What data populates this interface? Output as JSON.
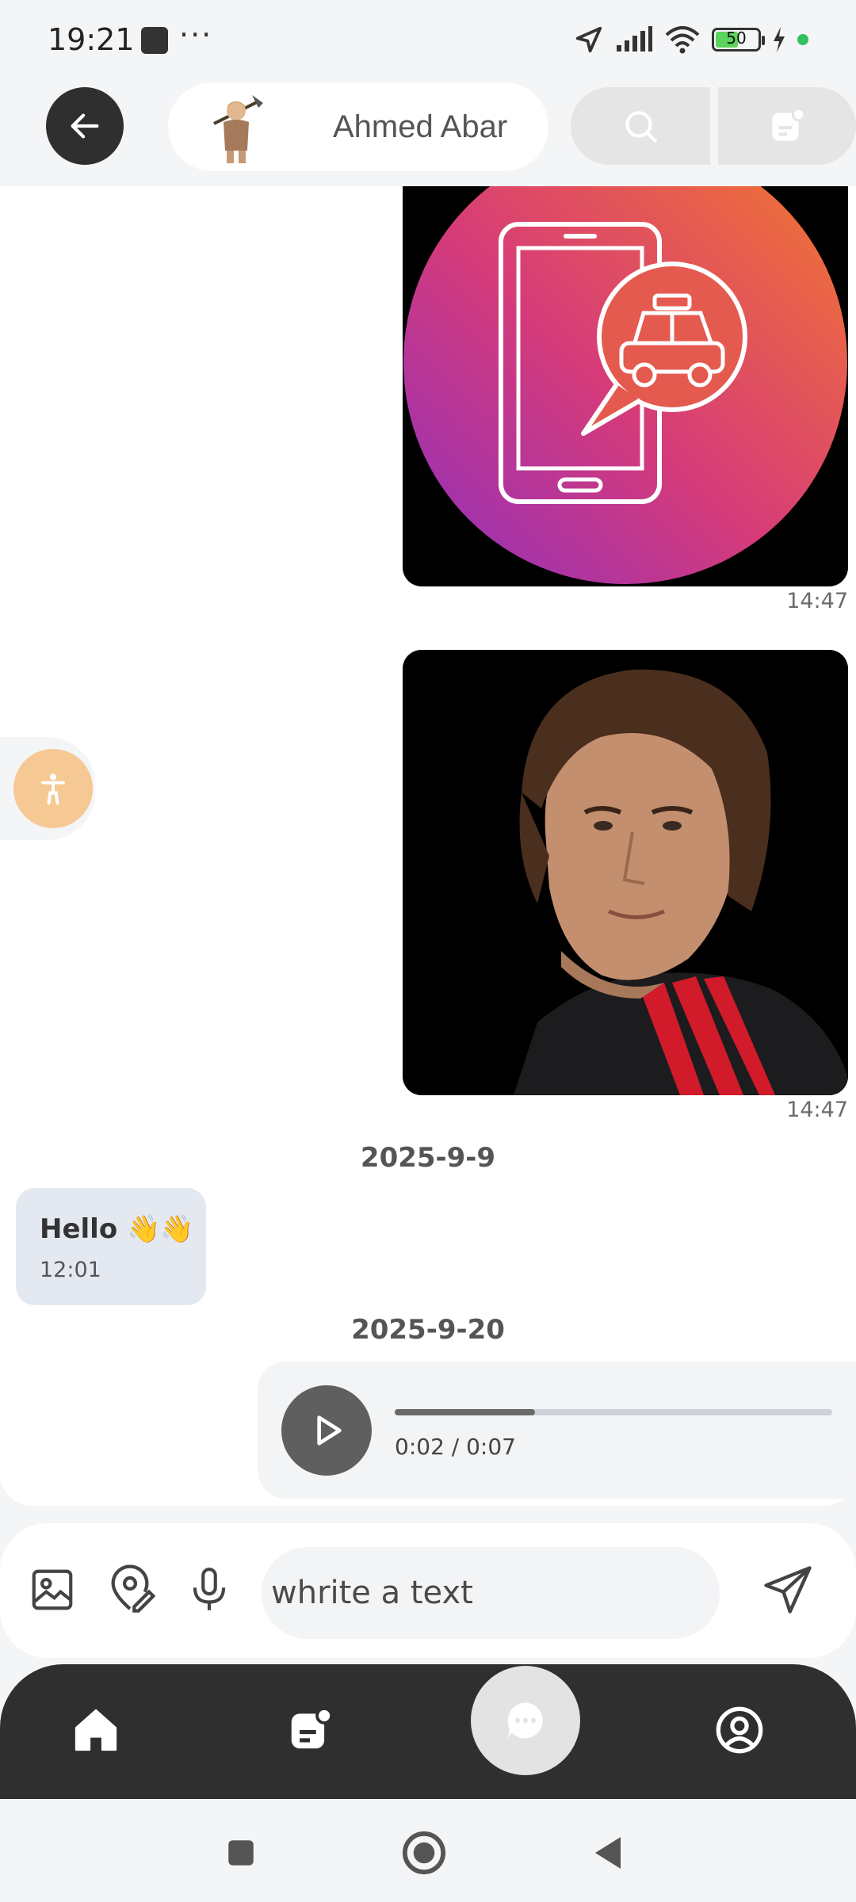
{
  "status_bar": {
    "time": "19:21",
    "overflow": "···",
    "battery": "50",
    "icons": [
      "location-arrow-icon",
      "signal-icon",
      "wifi-icon",
      "battery-icon",
      "charging-bolt-icon"
    ]
  },
  "header": {
    "contact_name": "Ahmed Abar"
  },
  "messages": {
    "image1_time": "14:47",
    "image2_time": "14:47",
    "date1": "2025-9-9",
    "incoming_text": "Hello 👋👋",
    "incoming_time": "12:01",
    "date2": "2025-9-20",
    "audio_time": "0:02 / 0:07",
    "audio_progress": 0.32
  },
  "composer": {
    "placeholder": "whrite a text"
  },
  "colors": {
    "dark": "#2f2f2f",
    "accessibility": "#f6c893",
    "incoming_bubble": "#e4e9f1",
    "gradient_start": "#a23bbf",
    "gradient_end": "#f47b2a"
  }
}
